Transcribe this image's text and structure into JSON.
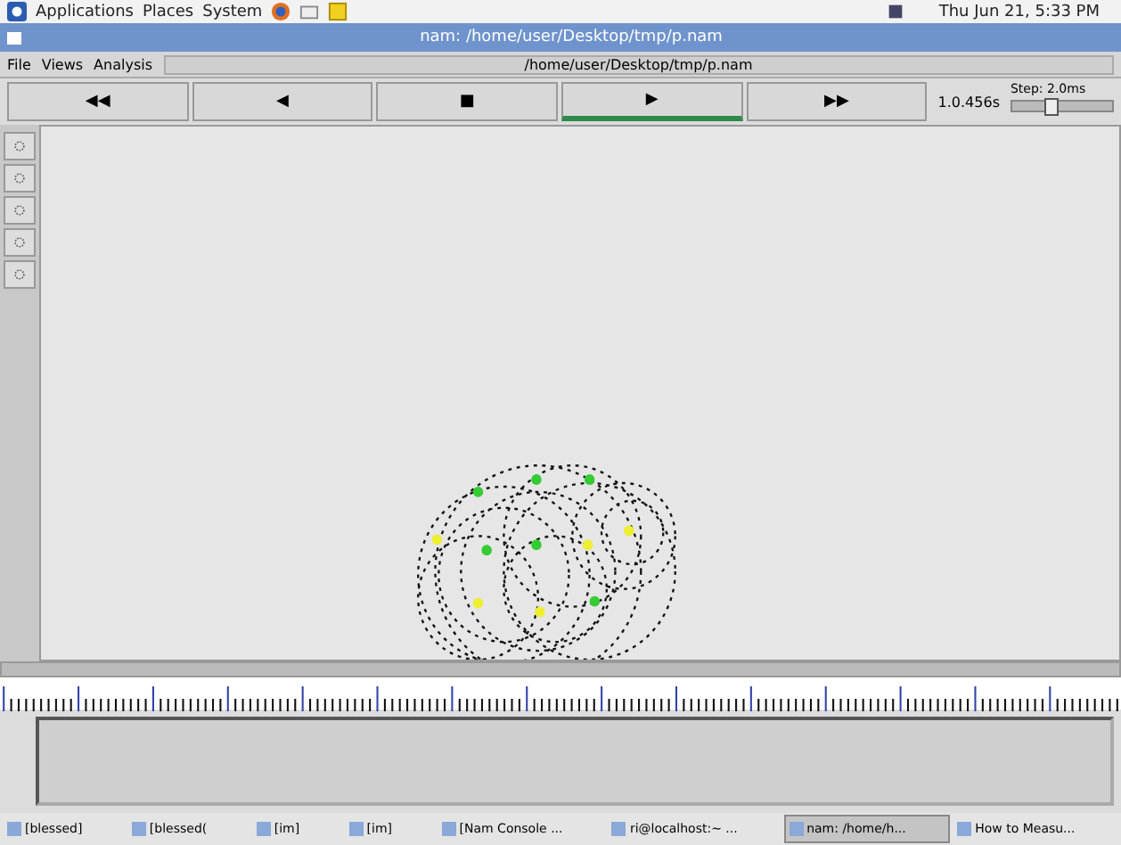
{
  "top_panel": {
    "menus": [
      "Applications",
      "Places",
      "System"
    ],
    "clock": "Thu Jun 21, 5:33 PM"
  },
  "window": {
    "title": "nam: /home/user/Desktop/tmp/p.nam"
  },
  "menu_bar": {
    "items": [
      "File",
      "Views",
      "Analysis"
    ],
    "file_path": "/home/user/Desktop/tmp/p.nam"
  },
  "controls": [
    {
      "label": "◀◀",
      "selected": false
    },
    {
      "label": "◀",
      "selected": false
    },
    {
      "label": "■",
      "selected": false
    },
    {
      "label": "▶",
      "selected": true
    },
    {
      "label": "▶▶",
      "selected": false
    }
  ],
  "time": "1.0.456s",
  "step": {
    "label": "Step: 2.0ms",
    "level": 0.4
  },
  "taskbar": [
    {
      "label": "[blessed]",
      "selected": false
    },
    {
      "label": "[blessed(",
      "selected": false
    },
    {
      "label": "[im]",
      "selected": false
    },
    {
      "label": "[im]",
      "selected": false
    },
    {
      "label": "[Nam Console ...",
      "selected": false
    },
    {
      "label": "ri@localhost:~ ...",
      "selected": false
    },
    {
      "label": "nam: /home/h...",
      "selected": true
    },
    {
      "label": "How to Measu...",
      "selected": false
    }
  ]
}
